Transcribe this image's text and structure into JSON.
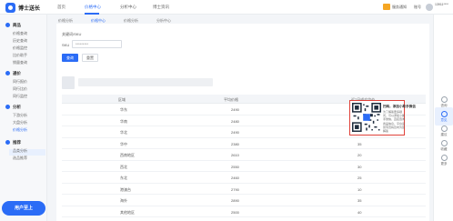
{
  "app": {
    "title": "博士送长"
  },
  "topnav": {
    "items": [
      {
        "label": "首页"
      },
      {
        "label": "价格中心"
      },
      {
        "label": "分析中心"
      },
      {
        "label": "博士资讯"
      }
    ],
    "active_index": 1,
    "right": {
      "notice": "服务通知",
      "account": "账号",
      "username": "13911****"
    }
  },
  "sidebar": {
    "groups": [
      {
        "label": "商品",
        "items": [
          "价格查询",
          "历史查询",
          "价格监控",
          "比价助手",
          "销量查询"
        ]
      },
      {
        "label": "通价",
        "items": [
          "同行报价",
          "同行比价",
          "同行监控"
        ]
      },
      {
        "label": "分析",
        "items": [
          "下游分析",
          "大盘分析",
          "价格分析"
        ]
      },
      {
        "label": "推荐",
        "items": [
          "品类分析",
          "选品推荐"
        ]
      }
    ],
    "active_item": "价格分析",
    "badge": "用户至上"
  },
  "tabs": [
    "价格分析",
    "价格中心",
    "价格分析",
    "分析中心",
    "推荐分析"
  ],
  "search": {
    "title": "关键词/SKU",
    "sku_label": "SKU",
    "sku_value": "*********",
    "search_button": "查询",
    "reset_button": "重置"
  },
  "table": {
    "columns": [
      "区域",
      "平均价格",
      "近7日成交均价"
    ],
    "rows": [
      {
        "region": "华东",
        "price": "2490",
        "avg7": "40"
      },
      {
        "region": "华南",
        "price": "2480",
        "avg7": "30"
      },
      {
        "region": "华北",
        "price": "2490",
        "avg7": "20"
      },
      {
        "region": "华中",
        "price": "2380",
        "avg7": "35"
      },
      {
        "region": "西南地区",
        "price": "2610",
        "avg7": "20"
      },
      {
        "region": "西北",
        "price": "2550",
        "avg7": "30"
      },
      {
        "region": "东北",
        "price": "2460",
        "avg7": "25"
      },
      {
        "region": "港澳台",
        "price": "2790",
        "avg7": "10"
      },
      {
        "region": "海外",
        "price": "2890",
        "avg7": "35"
      },
      {
        "region": "其他地区",
        "price": "2500",
        "avg7": "40"
      },
      {
        "region": "全国",
        "price": "2480",
        "avg7": "30"
      }
    ]
  },
  "popup": {
    "title": "扫码，添加小助手微信",
    "text": "为了解答更多疑问，可以添加小助手微信，直接咨询商品信息，平台运营专员将及时为您解答"
  },
  "rightbar": {
    "items": [
      "咨询",
      "意见",
      "建议",
      "收藏",
      "更多"
    ],
    "active_index": 1
  }
}
